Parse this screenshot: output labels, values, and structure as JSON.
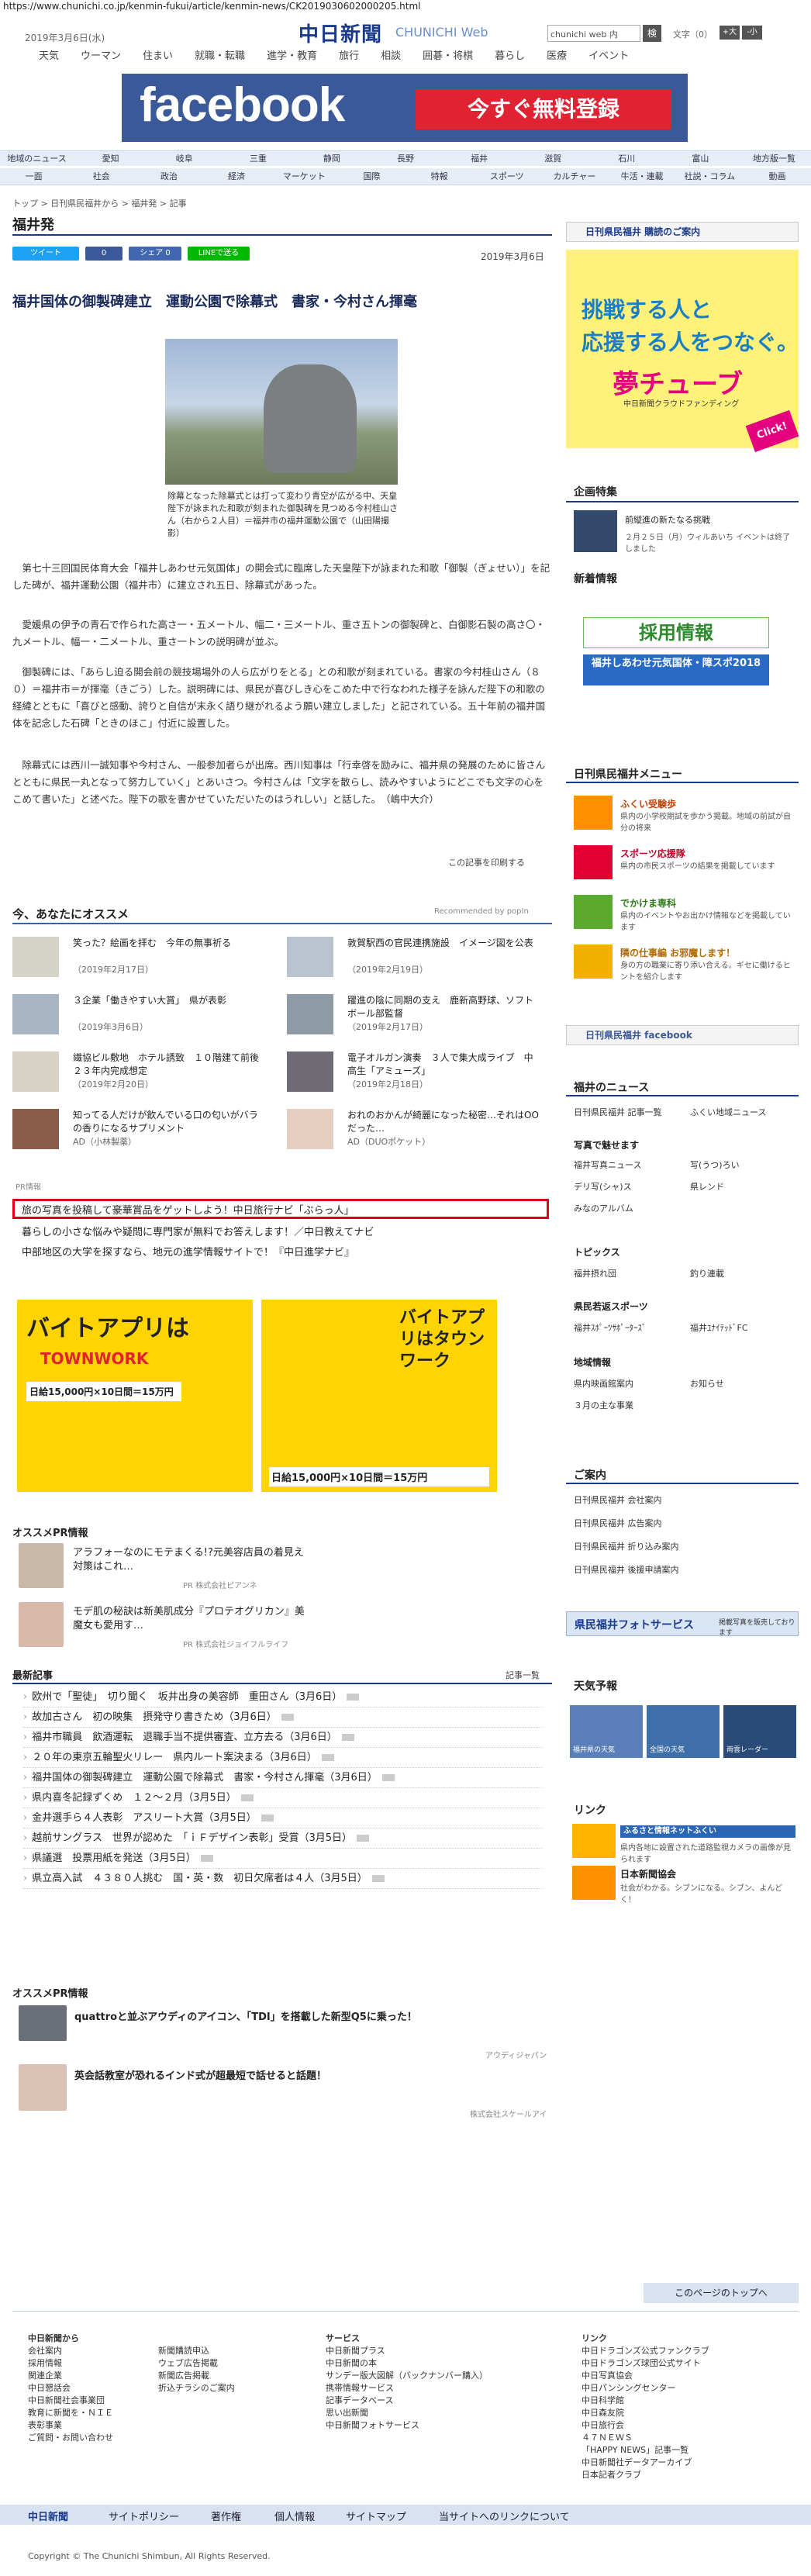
{
  "url": "https://www.chunichi.co.jp/kenmin-fukui/article/kenmin-news/CK2019030602000205.html",
  "header": {
    "date": "2019年3月6日(水)",
    "logo": "中日新聞",
    "logo_sub": "CHUNICHI Web",
    "search_placeholder": "chunichi web 内",
    "search_button": "検",
    "font_label": "文字（0）",
    "font_large": "+大",
    "font_small": "-小"
  },
  "topnav": [
    "天気",
    "ウーマン",
    "住まい",
    "就職・転職",
    "進学・教育",
    "旅行",
    "相談",
    "囲碁・将棋",
    "暮らし",
    "医療",
    "イベント"
  ],
  "ad": {
    "brand": "facebook",
    "cta": "今すぐ無料登録"
  },
  "regnav": [
    "地域のニュース",
    "愛知",
    "岐阜",
    "三重",
    "静岡",
    "長野",
    "福井",
    "滋賀",
    "石川",
    "富山",
    "地方版一覧"
  ],
  "catnav": [
    "一面",
    "社会",
    "政治",
    "経済",
    "マーケット",
    "国際",
    "特報",
    "スポーツ",
    "カルチャー",
    "牛活・連載",
    "社説・コラム",
    "動画"
  ],
  "breadcrumb": "トップ > 日刊県民福井から > 福井発 > 記事",
  "section_title": "福井発",
  "share": {
    "tweet": "ツイート",
    "like": "0",
    "share": "シェア 0",
    "line": "LINEで送る"
  },
  "article": {
    "date": "2019年3月6日",
    "title": "福井国体の御製碑建立　運動公園で除幕式　書家・今村さん揮毫",
    "caption": "除幕となった除幕式とは打って変わり青空が広がる中、天皇陛下が詠まれた和歌が刻まれた御製碑を見つめる今村桂山さん（右から２人目）＝福井市の福井運動公園で（山田陽撮影）",
    "p1": "　第七十三回国民体育大会「福井しあわせ元気国体」の開会式に臨席した天皇陛下が詠まれた和歌「御製（ぎょせい）」を記した碑が、福井運動公園（福井市）に建立され五日、除幕式があった。",
    "p2": "　愛媛県の伊予の青石で作られた高さ一・五メートル、幅二・三メートル、重さ五トンの御製碑と、白御影石製の高さ〇・九メートル、幅一・二メートル、重さ一トンの説明碑が並ぶ。",
    "p3": "　御製碑には、「あらし迫る開会前の競技場場外の人ら広がりをとる」との和歌が刻まれている。書家の今村桂山さん（８０）＝福井市＝が揮毫（きごう）した。説明碑には、県民が喜びしき心をこめた中で行なわれた様子を詠んだ陛下の和歌の経緯とともに「喜びと感動、誇りと自信が末永く語り継がれるよう願い建立しました」と記されている。五十年前の福井国体を記念した石碑「ときのほこ」付近に設置した。",
    "p4": "　除幕式には西川一誠知事や今村さん、一般参加者らが出席。西川知事は「行幸啓を励みに、福井県の発展のために皆さんとともに県民一丸となって努力していく」とあいさつ。今村さんは「文字を散らし、読みやすいようにどこでも文字の心をこめて書いた」と述べた。陛下の歌を書かせていただいたのはうれしい」と話した。　（嶋中大介）",
    "print": "この記事を印刷する"
  },
  "recommend": {
    "title": "今、あなたにオススメ",
    "by": "Recommended by popIn",
    "items": [
      {
        "text": "笑った？絵画を拝む　今年の無事祈る",
        "date": "（2019年2月17日）"
      },
      {
        "text": "敦賀駅西の官民連携施設　イメージ図を公表",
        "date": "（2019年2月19日）"
      },
      {
        "text": "３企業「働きやすい大賞」　県が表彰",
        "date": "（2019年3月6日）"
      },
      {
        "text": "躍進の陰に同期の支え　鹿新高野球、ソフトボール部監督",
        "date": "（2019年2月17日）"
      },
      {
        "text": "繊協ビル敷地　ホテル誘致　１０階建て前後　２３年内完成想定",
        "date": "（2019年2月20日）"
      },
      {
        "text": "電子オルガン演奏　３人で集大成ライブ　中高生「アミューズ」",
        "date": "（2019年2月18日）"
      },
      {
        "text": "知ってる人だけが飲んでいる口の匂いがバラの香りになるサプリメント",
        "date": "AD（小林製薬）"
      },
      {
        "text": "おれのおかんが綺麗になった秘密…それはOOだった…",
        "date": "AD（DUOポケット）"
      }
    ]
  },
  "pr": {
    "label": "PR情報",
    "links": [
      "旅の写真を投稿して豪華賞品をゲットしよう！中日旅行ナビ「ぶらっ人」",
      "暮らしの小さな悩みや疑問に専門家が無料でお答えします！／中日教えてナビ",
      "中部地区の大学を探すなら、地元の進学情報サイトで！『中日進学ナビ』"
    ]
  },
  "ad2": {
    "left": "バイトアプリは",
    "left_brand": "TOWNWORK",
    "left_pay": "日給15,000円×10日間＝15万円",
    "right": "バイトアプリはタウンワーク",
    "right_pay": "日給15,000円×10日間＝15万円"
  },
  "ospr1": {
    "title": "オススメPR情報",
    "items": [
      {
        "text": "アラフォーなのにモテまくる!?元美容店員の着見え対策はこれ…",
        "src": "PR 株式会社ピアンネ"
      },
      {
        "text": "モデ肌の秘訣は新美肌成分『プロテオグリカン』美魔女も愛用す…",
        "src": "PR 株式会社ジョイフルライフ"
      }
    ]
  },
  "latest": {
    "title": "最新記事",
    "more": "記事一覧",
    "items": [
      "欧州で「聖徒」　切り聞く　坂井出身の美容師　重田さん（3月6日）",
      "故加古さん　初の映集　摂発守り書きため（3月6日）",
      "福井市職員　飲酒運転　退職手当不提供審査、立方去る（3月6日）",
      "２０年の東京五輪聖火リレー　県内ルート案決まる（3月6日）",
      "福井国体の御製碑建立　運動公園で除幕式　書家・今村さん揮毫（3月6日）",
      "県内喜冬記録ずくめ　１２～２月（3月5日）",
      "金井選手ら４人表彰　アスリート大賞（3月5日）",
      "越前サングラス　世界が認めた　「ｉＦデザイン表彰」受賞（3月5日）",
      "県議選　投票用紙を発送（3月5日）",
      "県立高入試　４３８０人挑む　国・英・数　初日欠席者は４人（3月5日）"
    ]
  },
  "ospr2": {
    "title": "オススメPR情報",
    "items": [
      {
        "text": "quattroと並ぶアウディのアイコン、「TDI」を搭載した新型Q5に乗った！",
        "src": "アウディジャパン"
      },
      {
        "text": "英会話教室が恐れるインド式が超最短で話せると話題！",
        "src": "株式会社スケールアイ"
      }
    ]
  },
  "sidebar": {
    "subscribe": "日刊県民福井 購読のご案内",
    "ad_line1": "挑戦する人と",
    "ad_line2": "応援する人をつなぐ。",
    "ad_brand": "夢チューブ",
    "ad_sub": "中日新聞クラウドファンディング",
    "ad_click": "Click!",
    "feature_title": "企画特集",
    "feature_item": "前縦進の新たなる挑戦",
    "feature_sub": "２月２５日（月）ウィルあいち イベントは終了しました",
    "news_title": "新着情報",
    "saiyo": "採用情報",
    "kokutai": "福井しあわせ元気国体・障スポ2018",
    "menu_title": "日刊県民福井メニュー",
    "menu": [
      {
        "title": "ふくい受験歩",
        "sub": "県内の小学校期試を歩かう掲載。地域の前試が自分の将来"
      },
      {
        "title": "スポーツ応援隊",
        "sub": "県内の市民スポーツの結果を掲載しています"
      },
      {
        "title": "でかけま専科",
        "sub": "県内のイベントやお出かけ情報などを掲載しています"
      },
      {
        "title": "隣の仕事編 お邪魔します！",
        "sub": "身の方の職業に寄り添い合える。ギセに働けるヒントを紹介します"
      }
    ],
    "facebook": "日刊県民福井 facebook",
    "fukui_news": "福井のニュース",
    "grid1": [
      "日刊県民福井 記事一覧",
      "ふくい地域ニュース"
    ],
    "photo_title": "写真で魅せます",
    "grid2": [
      "福井写真ニュース",
      "写(うつ)ろい",
      "デリ写(シャ)ス",
      "県レンド",
      "みなのアルバム"
    ],
    "topics_title": "トピックス",
    "grid3": [
      "福井摂れ団",
      "釣り連載"
    ],
    "kenmin_title": "県民若返スポーツ",
    "grid4": [
      "福井ｽﾎﾟｰﾂｻﾎﾟｰﾀｰｽﾞ",
      "福井ﾕﾅｲﾃｯﾄﾞFC"
    ],
    "region_title": "地域情報",
    "grid5": [
      "県内映画館案内",
      "お知らせ",
      "３月の主な事業"
    ],
    "guide_title": "ご案内",
    "grid6": [
      "日刊県民福井 会社案内",
      "日刊県民福井 広告案内",
      "日刊県民福井 折り込み案内",
      "日刊県民福井 後援申請案内"
    ],
    "photo_service": "県民福井フォトサービス",
    "photo_service_sub": "掲載写真を販売しております",
    "weather_title": "天気予報",
    "weather": [
      "福井県の天気",
      "全国の天気",
      "雨雲レーダー"
    ],
    "link_title": "リンク",
    "link1": "ふるさと情報ネットふくい",
    "link1_sub": "県内各地に設置された道路監視カメラの画像が見られます",
    "link2": "日本新聞協会",
    "link2_sub": "社会がわかる。シブンになる。シブン、よんどく！"
  },
  "footer": {
    "totop": "このページのトップへ",
    "col1": [
      "中日新聞から",
      "会社案内",
      "採用情報",
      "関連企業",
      "中日懇話会",
      "中日新聞社会事業団",
      "教育に新聞を・ＮＩＥ",
      "表彰事業",
      "ご質問・お問い合わせ"
    ],
    "col2": [
      "",
      "新聞購読申込",
      "ウェブ広告掲載",
      "新聞広告掲載",
      "折込チラシのご案内"
    ],
    "col3": [
      "サービス",
      "中日新聞プラス",
      "中日新聞の本",
      "サンデー版大図解（バックナンバー購入）",
      "携帯情報サービス",
      "記事データベース",
      "思い出新聞",
      "中日新聞フォトサービス"
    ],
    "col4": [
      "リンク",
      "中日ドラゴンズ公式ファンクラブ",
      "中日ドラゴンズ球団公式サイト",
      "中日写真協会",
      "中日パンシングセンター",
      "中日科学館",
      "中日森友院",
      "中日旅行会",
      "４７ＮＥＷＳ",
      "「HAPPY NEWS」記事一覧",
      "中日新聞社データアーカイブ",
      "日本記者クラブ"
    ],
    "bar": [
      "中日新聞",
      "サイトポリシー",
      "著作権",
      "個人情報",
      "サイトマップ",
      "当サイトへのリンクについて"
    ],
    "copyright": "Copyright © The Chunichi Shimbun, All Rights Reserved."
  }
}
